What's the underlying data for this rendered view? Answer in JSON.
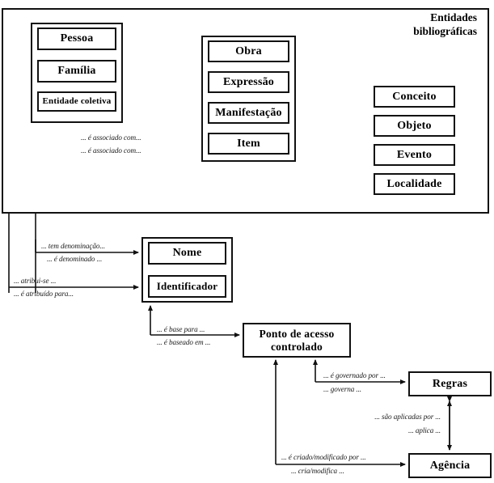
{
  "diagram": {
    "title": "Entidades bibliográficas",
    "panel_title_lines": [
      "Entidades",
      "bibliográficas"
    ],
    "entities": {
      "agent_group": [
        {
          "id": "pessoa",
          "label": "Pessoa"
        },
        {
          "id": "familia",
          "label": "Família"
        },
        {
          "id": "entidade-coletiva",
          "label": "Entidade coletiva"
        }
      ],
      "wemi_group": [
        {
          "id": "obra",
          "label": "Obra"
        },
        {
          "id": "expressao",
          "label": "Expressão"
        },
        {
          "id": "manifestacao",
          "label": "Manifestação"
        },
        {
          "id": "item",
          "label": "Item"
        }
      ],
      "subject_group": [
        {
          "id": "conceito",
          "label": "Conceito"
        },
        {
          "id": "objeto",
          "label": "Objeto"
        },
        {
          "id": "evento",
          "label": "Evento"
        },
        {
          "id": "localidade",
          "label": "Localidade"
        }
      ],
      "naming_group": [
        {
          "id": "nome",
          "label": "Nome"
        },
        {
          "id": "identificador",
          "label": "Identificador"
        }
      ],
      "standalone": [
        {
          "id": "ponto-de-acesso-controlado",
          "label_lines": [
            "Ponto de acesso",
            "controlado"
          ]
        },
        {
          "id": "regras",
          "label": "Regras"
        },
        {
          "id": "agencia",
          "label": "Agência"
        }
      ]
    },
    "relationships": [
      {
        "id": "associado-com-forward",
        "label": "... é associado com..."
      },
      {
        "id": "associado-com-reverse",
        "label": "... é associado com..."
      },
      {
        "id": "tem-denominacao",
        "label": "... tem denominação..."
      },
      {
        "id": "e-denominado",
        "label": "... é denominado ..."
      },
      {
        "id": "atribui-se",
        "label": "... atribui-se ..."
      },
      {
        "id": "e-atribuido-para",
        "label": "... é atribuído para..."
      },
      {
        "id": "e-base-para",
        "label": "... é base para ..."
      },
      {
        "id": "e-baseado-em",
        "label": "... é baseado em ..."
      },
      {
        "id": "e-governado-por",
        "label": "... é governado por ..."
      },
      {
        "id": "governa",
        "label": "... governa ..."
      },
      {
        "id": "sao-aplicadas-por",
        "label": "... são aplicadas por ..."
      },
      {
        "id": "aplica",
        "label": "... aplica ..."
      },
      {
        "id": "e-criado-modificado-por",
        "label": "... é criado/modificado por ..."
      },
      {
        "id": "cria-modifica",
        "label": "... cria/modifica ..."
      }
    ],
    "colors": {
      "stroke": "#111111",
      "background": "#ffffff",
      "text": "#000000"
    }
  }
}
